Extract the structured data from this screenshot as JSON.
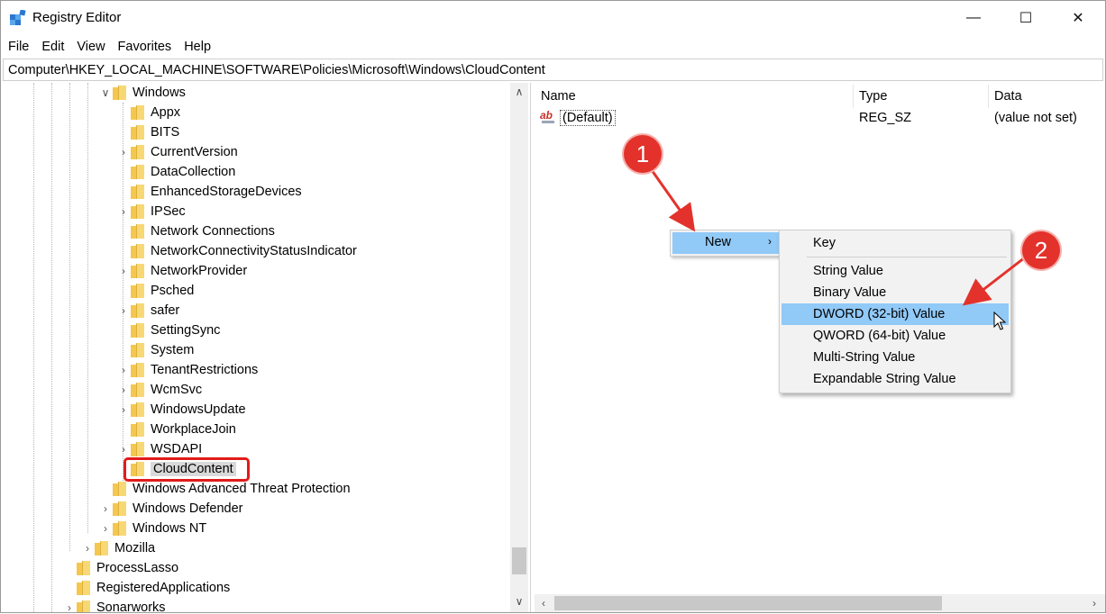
{
  "window": {
    "title": "Registry Editor",
    "controls": {
      "minimize": "—",
      "maximize": "☐",
      "close": "✕"
    }
  },
  "menubar": [
    "File",
    "Edit",
    "View",
    "Favorites",
    "Help"
  ],
  "address": "Computer\\HKEY_LOCAL_MACHINE\\SOFTWARE\\Policies\\Microsoft\\Windows\\CloudContent",
  "tree": [
    {
      "label": "Windows",
      "expander": "expanded"
    },
    {
      "label": "Appx",
      "expander": "none"
    },
    {
      "label": "BITS",
      "expander": "none"
    },
    {
      "label": "CurrentVersion",
      "expander": "collapsed"
    },
    {
      "label": "DataCollection",
      "expander": "none"
    },
    {
      "label": "EnhancedStorageDevices",
      "expander": "none"
    },
    {
      "label": "IPSec",
      "expander": "collapsed"
    },
    {
      "label": "Network Connections",
      "expander": "none"
    },
    {
      "label": "NetworkConnectivityStatusIndicator",
      "expander": "none"
    },
    {
      "label": "NetworkProvider",
      "expander": "collapsed"
    },
    {
      "label": "Psched",
      "expander": "none"
    },
    {
      "label": "safer",
      "expander": "collapsed"
    },
    {
      "label": "SettingSync",
      "expander": "none"
    },
    {
      "label": "System",
      "expander": "none"
    },
    {
      "label": "TenantRestrictions",
      "expander": "collapsed"
    },
    {
      "label": "WcmSvc",
      "expander": "collapsed"
    },
    {
      "label": "WindowsUpdate",
      "expander": "collapsed"
    },
    {
      "label": "WorkplaceJoin",
      "expander": "none"
    },
    {
      "label": "WSDAPI",
      "expander": "collapsed"
    },
    {
      "label": "CloudContent",
      "expander": "none",
      "selected": true
    },
    {
      "label": "Windows Advanced Threat Protection",
      "expander": "none"
    },
    {
      "label": "Windows Defender",
      "expander": "collapsed"
    },
    {
      "label": "Windows NT",
      "expander": "collapsed"
    },
    {
      "label": "Mozilla",
      "expander": "collapsed"
    },
    {
      "label": "ProcessLasso",
      "expander": "none"
    },
    {
      "label": "RegisteredApplications",
      "expander": "none"
    },
    {
      "label": "Sonarworks",
      "expander": "collapsed"
    }
  ],
  "list": {
    "columns": [
      "Name",
      "Type",
      "Data"
    ],
    "rows": [
      {
        "name": "(Default)",
        "type": "REG_SZ",
        "data": "(value not set)",
        "icon": "string-value-icon"
      }
    ]
  },
  "context_menu": {
    "new_label": "New",
    "submenu_arrow": "›",
    "submenu": [
      {
        "label": "Key"
      },
      {
        "label": "String Value"
      },
      {
        "label": "Binary Value"
      },
      {
        "label": "DWORD (32-bit) Value",
        "highlighted": true
      },
      {
        "label": "QWORD (64-bit) Value"
      },
      {
        "label": "Multi-String Value"
      },
      {
        "label": "Expandable String Value"
      }
    ]
  },
  "annotations": {
    "step1": "1",
    "step2": "2",
    "color": "#e3322b"
  },
  "colors": {
    "highlight": "#91c9f7",
    "selection_box": "#e11b1b",
    "folder": "#f5c74e"
  }
}
